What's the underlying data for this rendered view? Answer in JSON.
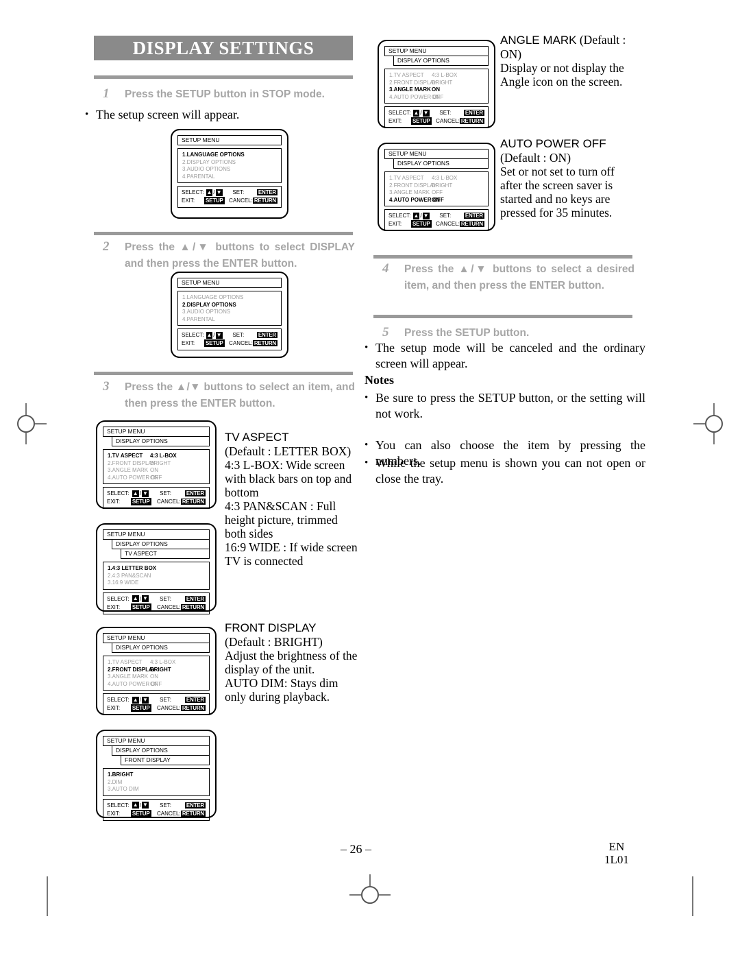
{
  "banner": {
    "title": "DISPLAY SETTINGS"
  },
  "steps": {
    "s1": {
      "num": "1",
      "text": "Press the SETUP button in STOP mode."
    },
    "s2": {
      "num": "2",
      "text": "Press the ▲/▼ buttons to select DISPLAY and then press the ENTER button."
    },
    "s3": {
      "num": "3",
      "text": "Press the ▲/▼ buttons to select an item, and then press the ENTER button."
    },
    "s4": {
      "num": "4",
      "text": "Press the ▲/▼ buttons to select a desired item, and then press the ENTER button."
    },
    "s5": {
      "num": "5",
      "text": "Press the SETUP button."
    }
  },
  "paras": {
    "p1": "The setup screen will appear.",
    "p5": "The setup mode will be canceled and the ordinary screen will appear."
  },
  "notes": {
    "heading": "Notes",
    "items": [
      "Be sure to press the SETUP button, or the setting will not work.",
      "You can also choose the item by pressing the numbers.",
      "While the setup menu is shown you can not open or close the tray."
    ]
  },
  "descriptions": {
    "tv_aspect": {
      "head": "TV ASPECT",
      "body": "(Default : LETTER BOX)\n4:3 L-BOX: Wide screen with black bars on top and bottom\n4:3 PAN&SCAN : Full height picture, trimmed both sides\n16:9 WIDE : If wide screen TV is connected"
    },
    "front_display": {
      "head": "FRONT DISPLAY",
      "body": " (Default : BRIGHT)\nAdjust the brightness of the display of the unit.\nAUTO DIM: Stays dim only during playback."
    },
    "angle_mark": {
      "head": "ANGLE MARK",
      "body": " (Default : ON)\nDisplay or not display the Angle icon on the screen."
    },
    "auto_power_off": {
      "head": "AUTO POWER OFF",
      "body": "(Default : ON)\nSet or not set to turn off after the screen saver is started and no keys are pressed for 35 minutes."
    }
  },
  "osd_footer": {
    "select_label": "SELECT:",
    "up_arrow": "▲",
    "slash": "/",
    "down_arrow": "▼",
    "set_label": "SET:",
    "enter_key": "ENTER",
    "exit_label": "EXIT:",
    "setup_key": "SETUP",
    "cancel_label": "CANCEL:",
    "return_key": "RETURN"
  },
  "menus": [
    {
      "id": "setup-main",
      "titles": [
        "SETUP MENU"
      ],
      "rows": [
        {
          "label": "1.LANGUAGE OPTIONS",
          "value": "",
          "selected": true
        },
        {
          "label": "2.DISPLAY OPTIONS",
          "value": "",
          "selected": false
        },
        {
          "label": "3.AUDIO OPTIONS",
          "value": "",
          "selected": false
        },
        {
          "label": "4.PARENTAL",
          "value": "",
          "selected": false
        }
      ]
    },
    {
      "id": "setup-display-selected",
      "titles": [
        "SETUP MENU"
      ],
      "rows": [
        {
          "label": "1.LANGUAGE OPTIONS",
          "value": "",
          "selected": false
        },
        {
          "label": "2.DISPLAY OPTIONS",
          "value": "",
          "selected": true
        },
        {
          "label": "3.AUDIO OPTIONS",
          "value": "",
          "selected": false
        },
        {
          "label": "4.PARENTAL",
          "value": "",
          "selected": false
        }
      ]
    },
    {
      "id": "display-options-tv-aspect",
      "titles": [
        "SETUP MENU",
        "DISPLAY OPTIONS"
      ],
      "rows": [
        {
          "label": "1.TV ASPECT",
          "value": "4:3 L-BOX",
          "selected": true
        },
        {
          "label": "2.FRONT DISPLAY",
          "value": "BRIGHT",
          "selected": false
        },
        {
          "label": "3.ANGLE MARK",
          "value": "ON",
          "selected": false
        },
        {
          "label": "4.AUTO POWER OFF",
          "value": "ON",
          "selected": false
        }
      ]
    },
    {
      "id": "tv-aspect-submenu",
      "titles": [
        "SETUP MENU",
        "DISPLAY OPTIONS",
        "TV ASPECT"
      ],
      "rows": [
        {
          "label": "1.4:3 LETTER BOX",
          "value": "",
          "selected": true
        },
        {
          "label": "2.4:3 PAN&SCAN",
          "value": "",
          "selected": false
        },
        {
          "label": "3.16:9 WIDE",
          "value": "",
          "selected": false
        }
      ]
    },
    {
      "id": "display-options-front-display",
      "titles": [
        "SETUP MENU",
        "DISPLAY OPTIONS"
      ],
      "rows": [
        {
          "label": "1.TV ASPECT",
          "value": "4:3 L-BOX",
          "selected": false
        },
        {
          "label": "2.FRONT DISPLAY",
          "value": "BRIGHT",
          "selected": true
        },
        {
          "label": "3.ANGLE MARK",
          "value": "ON",
          "selected": false
        },
        {
          "label": "4.AUTO POWER OFF",
          "value": "ON",
          "selected": false
        }
      ]
    },
    {
      "id": "front-display-submenu",
      "titles": [
        "SETUP MENU",
        "DISPLAY OPTIONS",
        "FRONT DISPLAY"
      ],
      "rows": [
        {
          "label": "1.BRIGHT",
          "value": "",
          "selected": true
        },
        {
          "label": "2.DIM",
          "value": "",
          "selected": false
        },
        {
          "label": "3.AUTO DIM",
          "value": "",
          "selected": false
        }
      ]
    },
    {
      "id": "display-options-angle-mark",
      "titles": [
        "SETUP MENU",
        "DISPLAY OPTIONS"
      ],
      "rows": [
        {
          "label": "1.TV ASPECT",
          "value": "4:3 L-BOX",
          "selected": false
        },
        {
          "label": "2.FRONT DISPLAY",
          "value": "BRIGHT",
          "selected": false
        },
        {
          "label": "3.ANGLE MARK",
          "value": "ON",
          "selected": true
        },
        {
          "label": "4.AUTO POWER OFF",
          "value": "ON",
          "selected": false
        }
      ]
    },
    {
      "id": "display-options-auto-power-off",
      "titles": [
        "SETUP MENU",
        "DISPLAY OPTIONS"
      ],
      "rows": [
        {
          "label": "1.TV ASPECT",
          "value": "4:3 L-BOX",
          "selected": false
        },
        {
          "label": "2.FRONT DISPLAY",
          "value": "BRIGHT",
          "selected": false
        },
        {
          "label": "3.ANGLE MARK",
          "value": "OFF",
          "selected": false
        },
        {
          "label": "4.AUTO POWER OFF",
          "value": "ON",
          "selected": true
        }
      ]
    }
  ],
  "footer": {
    "page_number": "– 26 –",
    "lang_code": "EN",
    "doc_code": "1L01"
  }
}
